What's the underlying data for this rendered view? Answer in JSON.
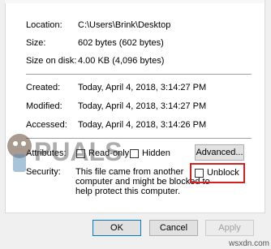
{
  "properties": {
    "location": {
      "label": "Location:",
      "value": "C:\\Users\\Brink\\Desktop"
    },
    "size": {
      "label": "Size:",
      "value": "602 bytes (602 bytes)"
    },
    "size_on_disk": {
      "label": "Size on disk:",
      "value": "4.00 KB (4,096 bytes)"
    },
    "created": {
      "label": "Created:",
      "value": "Today, April 4, 2018, 3:14:27 PM"
    },
    "modified": {
      "label": "Modified:",
      "value": "Today, April 4, 2018, 3:14:27 PM"
    },
    "accessed": {
      "label": "Accessed:",
      "value": "Today, April 4, 2018, 3:14:26 PM"
    }
  },
  "attributes": {
    "label": "Attributes:",
    "readonly_label": "Read-only",
    "hidden_label": "Hidden",
    "advanced_button": "Advanced..."
  },
  "security": {
    "label": "Security:",
    "message_line1": "This file came from another",
    "message_line2": "computer and might be blocked to",
    "message_line3": "help protect this computer.",
    "unblock_label": "Unblock"
  },
  "footer": {
    "ok_label": "OK",
    "cancel_label": "Cancel",
    "apply_label": "Apply"
  },
  "watermark": {
    "text": "PUALS",
    "site": "wsxdn.com"
  },
  "colors": {
    "highlight": "#d62020",
    "accent": "#0078d7"
  }
}
